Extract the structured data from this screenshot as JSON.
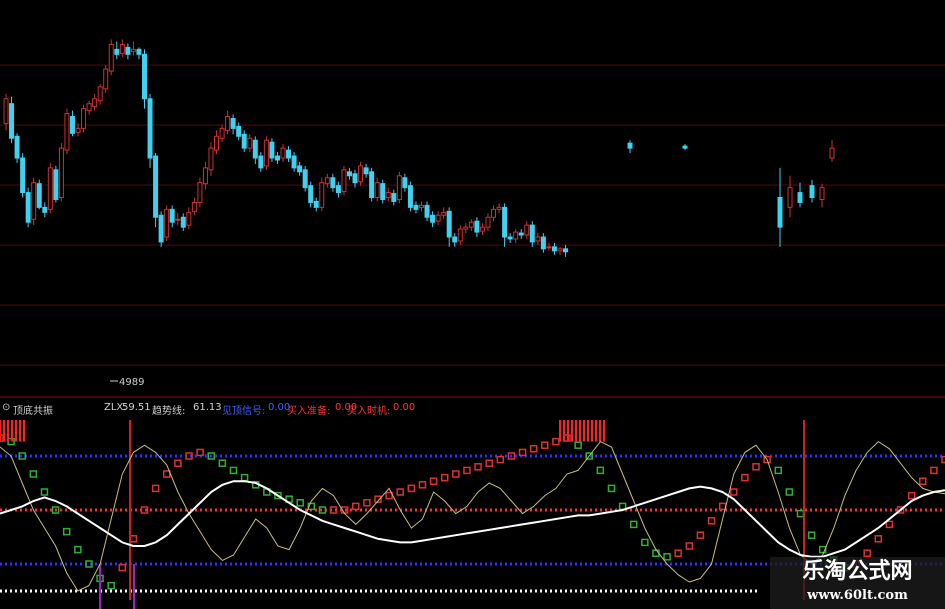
{
  "chart_data": [
    {
      "type": "candlestick",
      "title": "",
      "low_marker_label": "4989",
      "colors": {
        "up": "#d03030",
        "down": "#40d0f0"
      },
      "candles": [
        [
          275,
          300,
          268,
          305
        ],
        [
          295,
          260,
          255,
          302
        ],
        [
          262,
          240,
          235,
          265
        ],
        [
          240,
          205,
          200,
          245
        ],
        [
          205,
          175,
          170,
          210
        ],
        [
          178,
          215,
          172,
          220
        ],
        [
          214,
          190,
          188,
          218
        ],
        [
          190,
          185,
          180,
          195
        ],
        [
          188,
          230,
          184,
          235
        ],
        [
          228,
          198,
          195,
          232
        ],
        [
          200,
          250,
          196,
          255
        ],
        [
          248,
          285,
          244,
          290
        ],
        [
          282,
          265,
          262,
          288
        ],
        [
          266,
          270,
          262,
          275
        ],
        [
          270,
          290,
          266,
          294
        ],
        [
          288,
          295,
          284,
          298
        ],
        [
          292,
          300,
          288,
          305
        ],
        [
          298,
          312,
          294,
          315
        ],
        [
          310,
          330,
          306,
          334
        ],
        [
          328,
          355,
          324,
          360
        ],
        [
          350,
          345,
          340,
          358
        ],
        [
          346,
          355,
          342,
          360
        ],
        [
          352,
          345,
          340,
          356
        ],
        [
          348,
          350,
          344,
          358
        ],
        [
          350,
          345,
          340,
          352
        ],
        [
          345,
          300,
          290,
          350
        ],
        [
          300,
          240,
          230,
          305
        ],
        [
          242,
          180,
          170,
          245
        ],
        [
          182,
          155,
          150,
          186
        ],
        [
          160,
          188,
          156,
          192
        ],
        [
          188,
          175,
          170,
          192
        ],
        [
          178,
          178,
          172,
          184
        ],
        [
          180,
          170,
          166,
          184
        ],
        [
          172,
          185,
          168,
          190
        ],
        [
          186,
          195,
          182,
          200
        ],
        [
          195,
          215,
          190,
          220
        ],
        [
          214,
          230,
          208,
          236
        ],
        [
          228,
          250,
          222,
          256
        ],
        [
          248,
          262,
          244,
          268
        ],
        [
          260,
          270,
          256,
          274
        ],
        [
          268,
          282,
          264,
          288
        ],
        [
          280,
          270,
          264,
          284
        ],
        [
          272,
          262,
          258,
          276
        ],
        [
          264,
          250,
          246,
          268
        ],
        [
          250,
          260,
          246,
          264
        ],
        [
          258,
          240,
          234,
          262
        ],
        [
          242,
          230,
          226,
          246
        ],
        [
          232,
          258,
          228,
          262
        ],
        [
          256,
          240,
          236,
          260
        ],
        [
          242,
          238,
          234,
          246
        ],
        [
          240,
          250,
          236,
          254
        ],
        [
          248,
          240,
          236,
          252
        ],
        [
          242,
          230,
          226,
          246
        ],
        [
          232,
          226,
          222,
          236
        ],
        [
          228,
          210,
          206,
          232
        ],
        [
          212,
          195,
          190,
          216
        ],
        [
          196,
          190,
          186,
          200
        ],
        [
          190,
          215,
          186,
          220
        ],
        [
          214,
          220,
          210,
          224
        ],
        [
          220,
          210,
          206,
          224
        ],
        [
          212,
          205,
          200,
          216
        ],
        [
          206,
          228,
          202,
          232
        ],
        [
          226,
          222,
          218,
          230
        ],
        [
          224,
          215,
          210,
          228
        ],
        [
          216,
          232,
          212,
          236
        ],
        [
          230,
          224,
          220,
          234
        ],
        [
          226,
          200,
          196,
          230
        ],
        [
          200,
          215,
          196,
          220
        ],
        [
          214,
          198,
          194,
          218
        ],
        [
          200,
          205,
          196,
          210
        ],
        [
          204,
          196,
          192,
          208
        ],
        [
          198,
          222,
          194,
          226
        ],
        [
          220,
          210,
          206,
          224
        ],
        [
          212,
          190,
          186,
          216
        ],
        [
          192,
          188,
          184,
          196
        ],
        [
          190,
          192,
          186,
          196
        ],
        [
          192,
          180,
          176,
          196
        ],
        [
          182,
          175,
          170,
          186
        ],
        [
          176,
          182,
          172,
          186
        ],
        [
          182,
          185,
          178,
          190
        ],
        [
          186,
          160,
          150,
          190
        ],
        [
          160,
          155,
          150,
          164
        ],
        [
          156,
          168,
          152,
          172
        ],
        [
          168,
          170,
          164,
          174
        ],
        [
          170,
          175,
          166,
          178
        ],
        [
          176,
          165,
          160,
          180
        ],
        [
          166,
          170,
          162,
          174
        ],
        [
          170,
          180,
          166,
          184
        ],
        [
          180,
          188,
          176,
          192
        ],
        [
          188,
          190,
          184,
          194
        ],
        [
          190,
          160,
          150,
          194
        ],
        [
          160,
          158,
          154,
          164
        ],
        [
          158,
          165,
          154,
          168
        ],
        [
          164,
          162,
          158,
          168
        ],
        [
          162,
          172,
          158,
          176
        ],
        [
          172,
          155,
          150,
          176
        ],
        [
          156,
          160,
          152,
          164
        ],
        [
          160,
          148,
          144,
          164
        ],
        [
          150,
          150,
          146,
          154
        ],
        [
          150,
          146,
          142,
          154
        ],
        [
          146,
          148,
          142,
          150
        ],
        [
          148,
          145,
          140,
          152
        ]
      ]
    },
    {
      "type": "indicator",
      "title": "顶底共振",
      "legend": [
        {
          "name": "ZLX:",
          "value": "59.51",
          "color": "#d0d0d0"
        },
        {
          "name": "趋势线:",
          "value": "61.13",
          "color": "#d0d0d0"
        },
        {
          "name": "见顶信号:",
          "value": "0.00",
          "color": "#4060ff"
        },
        {
          "name": "买入准备:",
          "value": "0.00",
          "color": "#ff3030"
        },
        {
          "name": "买入时机:",
          "value": "0.00",
          "color": "#ff3030"
        }
      ],
      "trend_line": [
        48,
        50,
        52,
        55,
        57,
        55,
        52,
        48,
        44,
        40,
        36,
        32,
        30,
        30,
        32,
        36,
        42,
        48,
        54,
        60,
        64,
        66,
        66,
        65,
        62,
        58,
        54,
        50,
        47,
        44,
        42,
        40,
        38,
        36,
        34,
        33,
        32,
        32,
        33,
        34,
        35,
        36,
        37,
        38,
        39,
        40,
        41,
        42,
        43,
        44,
        45,
        46,
        47,
        47,
        48,
        49,
        50,
        52,
        54,
        56,
        58,
        60,
        62,
        63,
        62,
        60,
        56,
        50,
        44,
        38,
        32,
        28,
        25,
        24,
        24,
        26,
        28,
        32,
        36,
        40,
        45,
        50,
        55,
        58,
        60,
        61
      ],
      "zlx_line": [
        85,
        80,
        65,
        50,
        40,
        30,
        15,
        5,
        8,
        20,
        45,
        70,
        82,
        86,
        82,
        75,
        60,
        48,
        38,
        28,
        22,
        25,
        35,
        45,
        40,
        30,
        28,
        40,
        55,
        62,
        58,
        48,
        42,
        48,
        55,
        62,
        50,
        40,
        45,
        60,
        55,
        48,
        52,
        60,
        65,
        62,
        55,
        48,
        52,
        58,
        62,
        70,
        72,
        80,
        88,
        85,
        70,
        55,
        40,
        28,
        20,
        14,
        10,
        12,
        20,
        45,
        70,
        82,
        86,
        78,
        60,
        40,
        25,
        20,
        25,
        40,
        58,
        72,
        82,
        88,
        84,
        76,
        68,
        62,
        60,
        59
      ],
      "osc_bars": [
        90,
        88,
        80,
        70,
        60,
        50,
        38,
        28,
        20,
        12,
        8,
        18,
        34,
        50,
        62,
        70,
        76,
        80,
        82,
        80,
        76,
        72,
        68,
        64,
        60,
        58,
        56,
        54,
        52,
        50,
        50,
        50,
        52,
        54,
        56,
        58,
        60,
        62,
        64,
        66,
        68,
        70,
        72,
        74,
        76,
        78,
        80,
        82,
        84,
        86,
        88,
        90,
        86,
        80,
        72,
        62,
        52,
        42,
        32,
        26,
        24,
        26,
        30,
        36,
        44,
        52,
        60,
        68,
        74,
        78,
        72,
        60,
        48,
        36,
        28,
        22,
        18,
        20,
        26,
        34,
        42,
        50,
        58,
        66,
        72,
        78
      ],
      "ylim": [
        0,
        100
      ],
      "levels": [
        {
          "value": 80,
          "color": "#3030ff"
        },
        {
          "value": 20,
          "color": "#3030ff"
        },
        {
          "value": 50,
          "color": "#ff3030"
        }
      ]
    }
  ],
  "watermark": {
    "title": "乐淘公式网",
    "url": "www.60lt.com"
  }
}
